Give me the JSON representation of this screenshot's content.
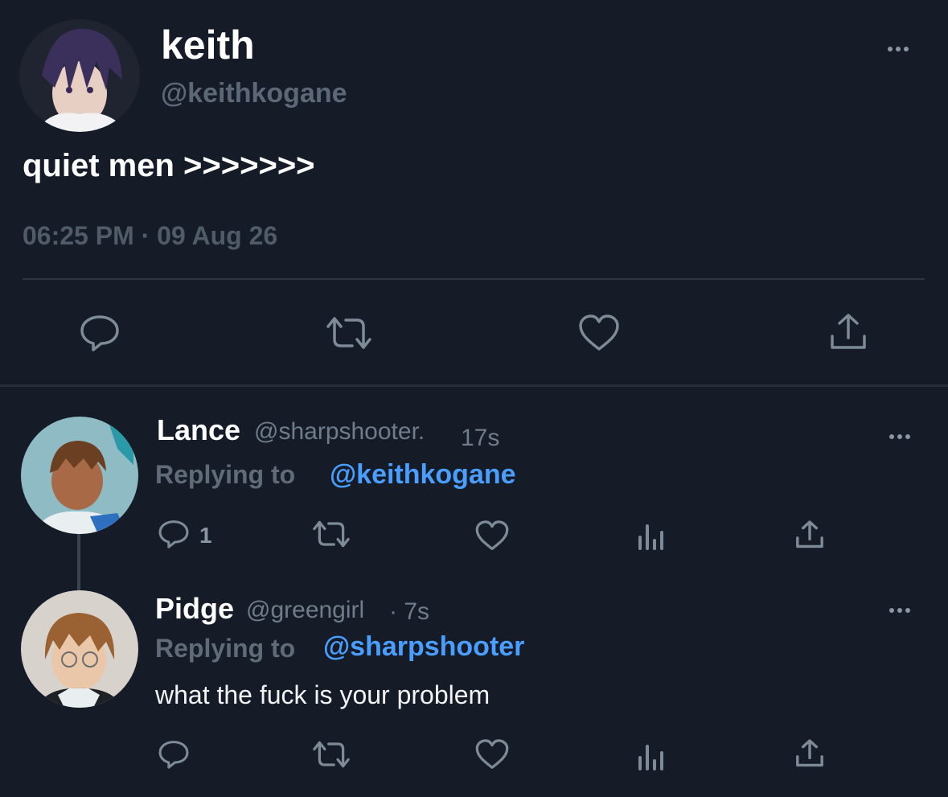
{
  "colors": {
    "background": "#151c27",
    "text": "#ffffff",
    "muted": "#6e7c8c",
    "link": "#4a9eff",
    "divider": "#2c3540"
  },
  "main_post": {
    "display_name": "keith",
    "handle": "@keithkogane",
    "text": "quiet men >>>>>>>",
    "timestamp": "06:25 PM · 09 Aug 26",
    "actions": [
      "reply-icon",
      "repost-icon",
      "like-icon",
      "share-icon"
    ]
  },
  "replies": [
    {
      "display_name": "Lance",
      "handle": "@sharpshooter.",
      "time": "17s",
      "replying_label": "Replying to",
      "replying_to": "@keithkogane",
      "text": "",
      "reply_count": "1"
    },
    {
      "display_name": "Pidge",
      "handle": "@greengirl",
      "time": "· 7s",
      "replying_label": "Replying to",
      "replying_to": "@sharpshooter",
      "text": "what the fuck is your problem",
      "reply_count": ""
    }
  ]
}
